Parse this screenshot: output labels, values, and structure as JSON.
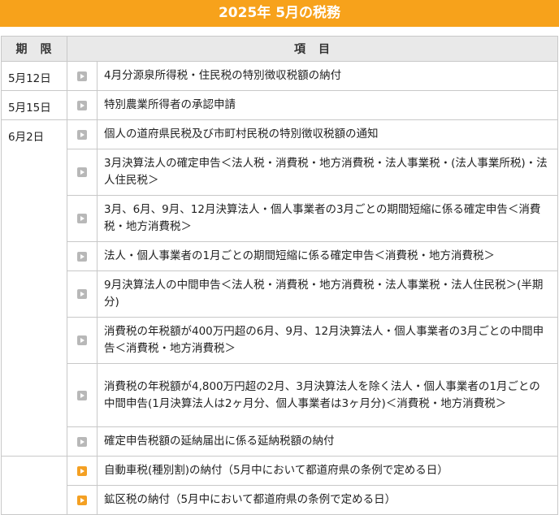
{
  "title": "2025年 5月の税務",
  "headers": {
    "period": "期　限",
    "items": "項　目"
  },
  "colors": {
    "title_bg": "#f7a21b",
    "header_bg": "#e9e9e9",
    "icon_gray": "#b8b8b8",
    "icon_orange": "#f4a023"
  },
  "rows": [
    {
      "date": "5月12日",
      "icon": "play-icon-gray",
      "text": "4月分源泉所得税・住民税の特別徴収税額の納付"
    },
    {
      "date": "5月15日",
      "icon": "play-icon-gray",
      "text": "特別農業所得者の承認申請"
    },
    {
      "date": "6月2日",
      "icon": "play-icon-gray",
      "text": "個人の道府県民税及び市町村民税の特別徴収税額の通知"
    },
    {
      "date": "",
      "icon": "play-icon-gray",
      "text": "3月決算法人の確定申告＜法人税・消費税・地方消費税・法人事業税・(法人事業所税)・法人住民税＞"
    },
    {
      "date": "",
      "icon": "play-icon-gray",
      "text": "3月、6月、9月、12月決算法人・個人事業者の3月ごとの期間短縮に係る確定申告＜消費税・地方消費税＞"
    },
    {
      "date": "",
      "icon": "play-icon-gray",
      "text": "法人・個人事業者の1月ごとの期間短縮に係る確定申告＜消費税・地方消費税＞"
    },
    {
      "date": "",
      "icon": "play-icon-gray",
      "text": "9月決算法人の中間申告＜法人税・消費税・地方消費税・法人事業税・法人住民税＞(半期分)"
    },
    {
      "date": "",
      "icon": "play-icon-gray",
      "text": "消費税の年税額が400万円超の6月、9月、12月決算法人・個人事業者の3月ごとの中間申告＜消費税・地方消費税＞"
    },
    {
      "date": "",
      "icon": "play-icon-gray",
      "text": "消費税の年税額が4,800万円超の2月、3月決算法人を除く法人・個人事業者の1月ごとの中間申告(1月決算法人は2ヶ月分、個人事業者は3ヶ月分)＜消費税・地方消費税＞"
    },
    {
      "date": "",
      "icon": "play-icon-gray",
      "text": "確定申告税額の延納届出に係る延納税額の納付"
    },
    {
      "date": "",
      "icon": "play-icon-orange",
      "text": "自動車税(種別割)の納付（5月中において都道府県の条例で定める日）"
    },
    {
      "date": "",
      "icon": "play-icon-orange",
      "text": "鉱区税の納付（5月中において都道府県の条例で定める日）"
    }
  ]
}
